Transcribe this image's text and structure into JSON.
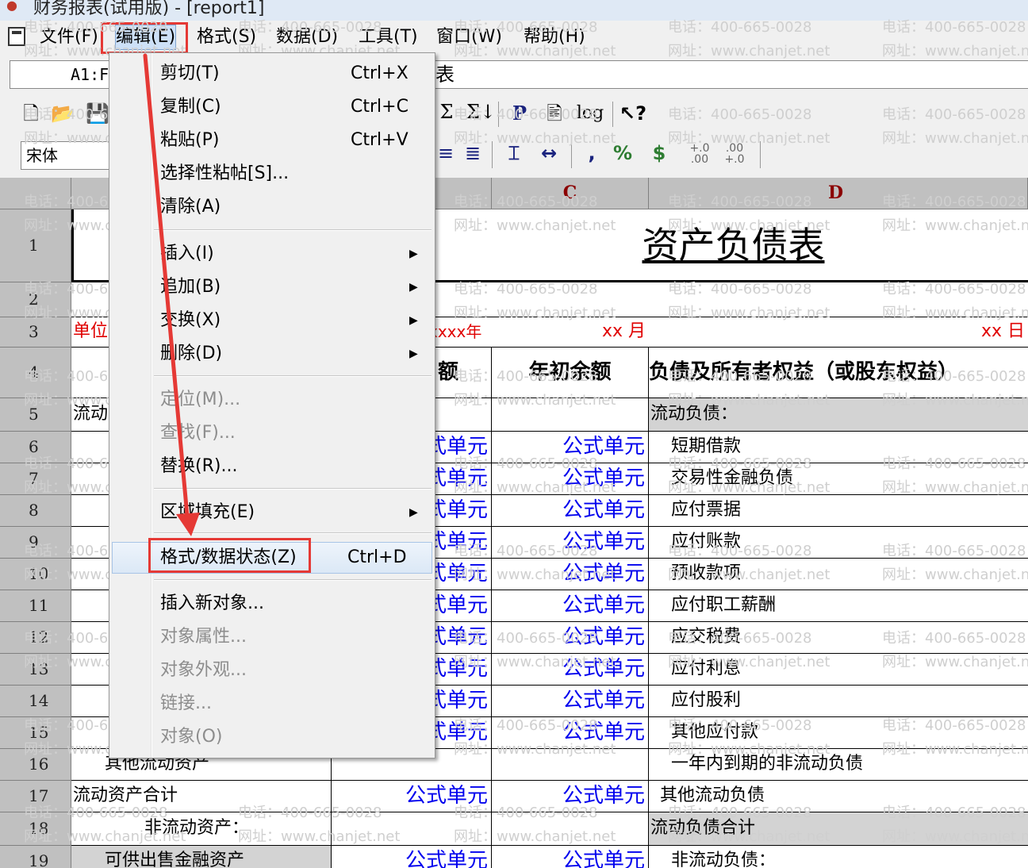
{
  "window": {
    "title": "财务报表(试用版) - [report1]"
  },
  "menubar": {
    "items": [
      {
        "label": "文件(F)"
      },
      {
        "label": "编辑(E)"
      },
      {
        "label": "格式(S)"
      },
      {
        "label": "数据(D)"
      },
      {
        "label": "工具(T)"
      },
      {
        "label": "窗口(W)"
      },
      {
        "label": "帮助(H)"
      }
    ]
  },
  "formula_bar": {
    "cell_ref": "A1:F",
    "content": "表"
  },
  "toolbar": {
    "font_name": "宋体",
    "buttons": [
      "new",
      "open",
      "save",
      "sum",
      "sum-sort",
      "P",
      "page",
      "log",
      "help-pointer",
      "align-center",
      "align-right",
      "row-height",
      "col-width",
      "comma",
      ",",
      "%",
      "$",
      ".00+.0",
      ".00→.0"
    ]
  },
  "edit_menu": {
    "items": [
      {
        "label": "剪切(T)",
        "shortcut": "Ctrl+X",
        "enabled": true
      },
      {
        "label": "复制(C)",
        "shortcut": "Ctrl+C",
        "enabled": true
      },
      {
        "label": "粘贴(P)",
        "shortcut": "Ctrl+V",
        "enabled": true
      },
      {
        "label": "选择性粘帖[S]...",
        "shortcut": "",
        "enabled": true
      },
      {
        "label": "清除(A)",
        "shortcut": "",
        "enabled": true
      },
      {
        "label": "插入(I)",
        "shortcut": "",
        "enabled": true,
        "submenu": true
      },
      {
        "label": "追加(B)",
        "shortcut": "",
        "enabled": true,
        "submenu": true
      },
      {
        "label": "交换(X)",
        "shortcut": "",
        "enabled": true,
        "submenu": true
      },
      {
        "label": "删除(D)",
        "shortcut": "",
        "enabled": true,
        "submenu": true
      },
      {
        "label": "定位(M)...",
        "shortcut": "",
        "enabled": false
      },
      {
        "label": "查找(F)...",
        "shortcut": "",
        "enabled": false
      },
      {
        "label": "替换(R)...",
        "shortcut": "",
        "enabled": true
      },
      {
        "label": "区域填充(E)",
        "shortcut": "",
        "enabled": true,
        "submenu": true
      },
      {
        "label": "格式/数据状态(Z)",
        "shortcut": "Ctrl+D",
        "enabled": true
      },
      {
        "label": "插入新对象...",
        "shortcut": "",
        "enabled": true
      },
      {
        "label": "对象属性...",
        "shortcut": "",
        "enabled": false
      },
      {
        "label": "对象外观...",
        "shortcut": "",
        "enabled": false
      },
      {
        "label": "链接...",
        "shortcut": "",
        "enabled": false
      },
      {
        "label": "对象(O)",
        "shortcut": "",
        "enabled": false
      }
    ]
  },
  "sheet": {
    "columns": [
      "C",
      "D"
    ],
    "rows": [
      "1",
      "2",
      "3",
      "4",
      "5",
      "6",
      "7",
      "8",
      "9",
      "10",
      "11",
      "12",
      "13",
      "14",
      "15",
      "16",
      "17",
      "18",
      "19"
    ],
    "title": "资产负债表",
    "unit_label": "单位",
    "year_label": "xxxx年",
    "month_label": "xx 月",
    "day_label": "xx 日",
    "header_b": "额",
    "header_c": "年初余额",
    "header_d": "负债及所有者权益（或股东权益）",
    "row5_a": "流动",
    "row5_d": "流动负债：",
    "formula_label": "公式单元",
    "formula_partial": "式单元",
    "row_a_fragments": [
      "其他流动资产",
      "流动资产合计",
      "非流动资产：",
      "可供出售金融资产"
    ],
    "liabilities": [
      "短期借款",
      "交易性金融负债",
      "应付票据",
      "应付账款",
      "预收款项",
      "应付职工薪酬",
      "应交税费",
      "应付利息",
      "应付股利",
      "其他应付款",
      "一年内到期的非流动负债",
      "其他流动负债",
      "流动负债合计",
      "非流动负债："
    ]
  },
  "watermark": {
    "phone": "电话：400-665-0028",
    "site": "网址：www.chanjet.net"
  }
}
